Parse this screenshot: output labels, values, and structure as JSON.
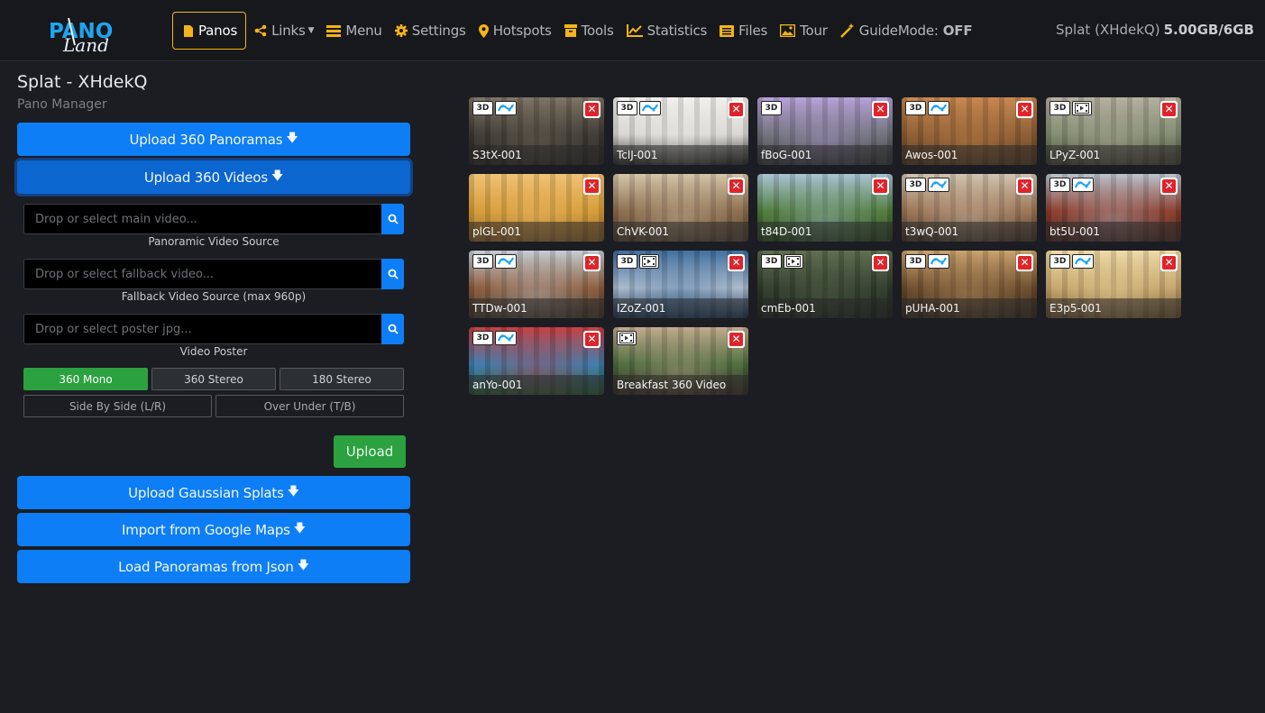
{
  "brand": {
    "line1": "PANO",
    "line2": "Land"
  },
  "nav": {
    "items": [
      {
        "label": "Panos",
        "icon": "file-icon",
        "active": true
      },
      {
        "label": "Links",
        "icon": "share-icon",
        "dropdown": true
      },
      {
        "label": "Menu",
        "icon": "list-icon"
      },
      {
        "label": "Settings",
        "icon": "gear-icon"
      },
      {
        "label": "Hotspots",
        "icon": "map-pin-icon"
      },
      {
        "label": "Tools",
        "icon": "archive-icon"
      },
      {
        "label": "Statistics",
        "icon": "line-chart-icon"
      },
      {
        "label": "Files",
        "icon": "files-icon"
      },
      {
        "label": "Tour",
        "icon": "image-icon"
      },
      {
        "label": "GuideMode:",
        "icon": "magic-wand-icon",
        "status": "OFF"
      }
    ],
    "project": "Splat (XHdekQ)",
    "quota": "5.00GB/6GB"
  },
  "page": {
    "title": "Splat - XHdekQ",
    "subtitle": "Pano Manager"
  },
  "panel": {
    "upload_panoramas": "Upload 360 Panoramas",
    "upload_videos": "Upload 360 Videos",
    "main_video_placeholder": "Drop or select main video...",
    "main_video_label": "Panoramic Video Source",
    "fallback_placeholder": "Drop or select fallback video...",
    "fallback_label": "Fallback Video Source (max 960p)",
    "poster_placeholder": "Drop or select poster jpg...",
    "poster_label": "Video Poster",
    "modes": [
      "360 Mono",
      "360 Stereo",
      "180 Stereo"
    ],
    "selected_mode": "360 Mono",
    "layouts": [
      "Side By Side (L/R)",
      "Over Under (T/B)"
    ],
    "upload": "Upload",
    "upload_splats": "Upload Gaussian Splats",
    "import_google": "Import from Google Maps",
    "load_json": "Load Panoramas from Json"
  },
  "panos": [
    {
      "name": "S3tX-001",
      "badges": [
        "3d",
        "splat"
      ],
      "colors": [
        "#3a3630",
        "#7b7060",
        "#2a2622"
      ]
    },
    {
      "name": "TclJ-001",
      "badges": [
        "3d",
        "splat"
      ],
      "colors": [
        "#d8d6d2",
        "#f0efeb",
        "#2a2a2a"
      ]
    },
    {
      "name": "fBoG-001",
      "badges": [
        "3d"
      ],
      "colors": [
        "#6d6f78",
        "#b59ed8",
        "#3a3b40"
      ]
    },
    {
      "name": "Awos-001",
      "badges": [
        "3d",
        "splat"
      ],
      "colors": [
        "#8a5a30",
        "#c6844a",
        "#5a3a20"
      ]
    },
    {
      "name": "LPyZ-001",
      "badges": [
        "3d",
        "video"
      ],
      "colors": [
        "#7f8a6e",
        "#b3ad9c",
        "#4a4638"
      ]
    },
    {
      "name": "plGL-001",
      "badges": [],
      "colors": [
        "#d49a34",
        "#f0c070",
        "#9a6a2a"
      ]
    },
    {
      "name": "ChVK-001",
      "badges": [],
      "colors": [
        "#8a6a4a",
        "#d2c4a8",
        "#5a4634"
      ]
    },
    {
      "name": "t84D-001",
      "badges": [],
      "colors": [
        "#4e7a3a",
        "#a6c2d2",
        "#2e4a22"
      ]
    },
    {
      "name": "t3wQ-001",
      "badges": [
        "3d",
        "splat"
      ],
      "colors": [
        "#9a7252",
        "#d0c2ae",
        "#4a3a2e"
      ]
    },
    {
      "name": "bt5U-001",
      "badges": [
        "3d",
        "splat"
      ],
      "colors": [
        "#8a3a2a",
        "#b8c2cc",
        "#4a2a22"
      ]
    },
    {
      "name": "TTDw-001",
      "badges": [
        "3d",
        "splat"
      ],
      "colors": [
        "#8a5a3a",
        "#c4ccd4",
        "#4a3a2e"
      ]
    },
    {
      "name": "IZoZ-001",
      "badges": [
        "3d",
        "video"
      ],
      "colors": [
        "#a8b8cc",
        "#3a6a9a",
        "#1f3a5a"
      ]
    },
    {
      "name": "cmEb-001",
      "badges": [
        "3d",
        "video"
      ],
      "colors": [
        "#2e3a2a",
        "#5a6a4a",
        "#1a221a"
      ]
    },
    {
      "name": "pUHA-001",
      "badges": [
        "3d",
        "splat"
      ],
      "colors": [
        "#6a4a2a",
        "#c8a06a",
        "#3a2a1a"
      ]
    },
    {
      "name": "E3p5-001",
      "badges": [
        "3d",
        "splat"
      ],
      "colors": [
        "#c4a46a",
        "#eed8a4",
        "#7a5a34"
      ]
    },
    {
      "name": "anYo-001",
      "badges": [
        "3d",
        "splat"
      ],
      "colors": [
        "#3a7aaa",
        "#c43a3a",
        "#2a5a3a"
      ]
    },
    {
      "name": "Breakfast 360 Video",
      "badges": [
        "video"
      ],
      "colors": [
        "#4a6a3a",
        "#c0a88a",
        "#3a2a22"
      ]
    }
  ],
  "colors": {
    "accent": "#f4b41a",
    "primary": "#0d7ef5",
    "success": "#2ba13f",
    "danger": "#e0242b"
  }
}
